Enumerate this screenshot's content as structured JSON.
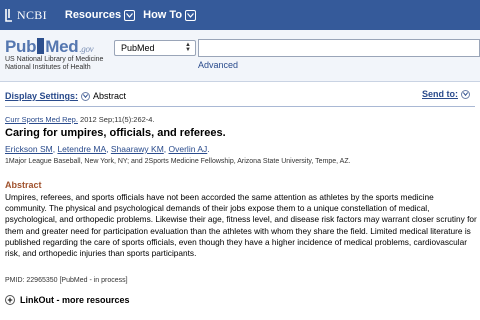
{
  "topbar": {
    "logo_text": "NCBI",
    "nav": [
      {
        "label": "Resources"
      },
      {
        "label": "How To"
      }
    ]
  },
  "pubmed_header": {
    "logo_pub": "Pub",
    "logo_med": "Med",
    "logo_gov": ".gov",
    "sub_line1": "US National Library of Medicine",
    "sub_line2": "National Institutes of Health",
    "database_selected": "PubMed",
    "search_value": "",
    "advanced_label": "Advanced"
  },
  "display": {
    "settings_label": "Display Settings:",
    "settings_value": "Abstract",
    "send_to_label": "Send to:"
  },
  "article": {
    "journal": "Curr Sports Med Rep.",
    "citation_rest": " 2012 Sep;11(5):262-4.",
    "title": "Caring for umpires, officials, and referees.",
    "authors": [
      "Erickson SM",
      "Letendre MA",
      "Shaarawy KM",
      "Overlin AJ"
    ],
    "authors_end": ".",
    "affiliation": "1Major League Baseball, New York, NY; and 2Sports Medicine Fellowship, Arizona State University, Tempe, AZ.",
    "abstract_heading": "Abstract",
    "abstract_text": "Umpires, referees, and sports officials have not been accorded the same attention as athletes by the sports medicine community. The physical and psychological demands of their jobs expose them to a unique constellation of medical, psychological, and orthopedic problems. Likewise their age, fitness level, and disease risk factors may warrant closer scrutiny for them and greater need for participation evaluation than the athletes with whom they share the field. Limited medical literature is published regarding the care of sports officials, even though they have a higher incidence of medical problems, cardiovascular risk, and orthopedic injuries than sports participants.",
    "pmid": "PMID: 22965350 [PubMed - in process]"
  },
  "linkout": {
    "label": "LinkOut - more resources"
  },
  "colors": {
    "topbar": "#355a9a",
    "link": "#2a4b8c",
    "abstract_heading": "#a0522d"
  }
}
